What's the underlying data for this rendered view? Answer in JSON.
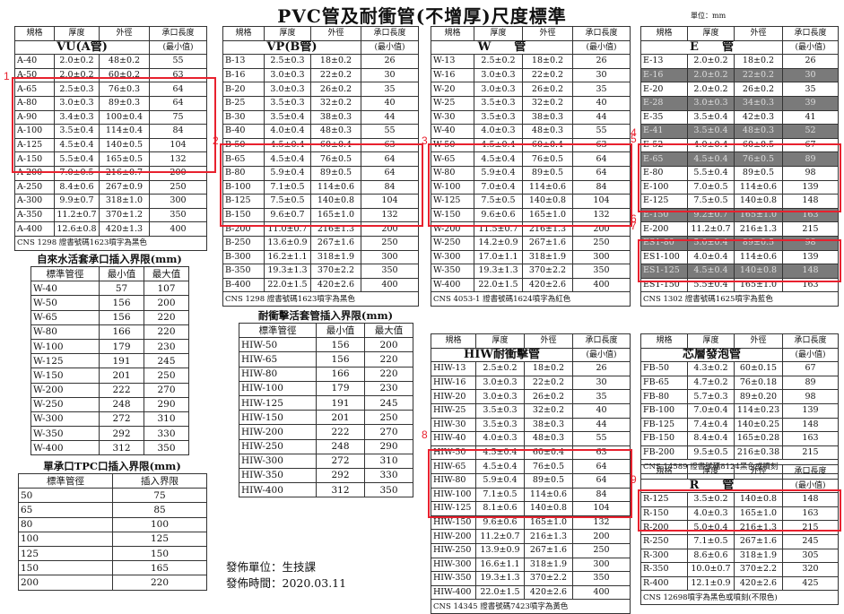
{
  "title": "PVC管及耐衝管(不增厚)尺度標準",
  "unit_label": "單位：mm",
  "headers": [
    "規格",
    "厚度",
    "外徑",
    "承口長度"
  ],
  "vu": {
    "name": "VU(A管)",
    "minlabel": "(最小值)",
    "rows": [
      [
        "A-40",
        "2.0±0.2",
        "48±0.2",
        "55"
      ],
      [
        "A-50",
        "2.0±0.2",
        "60±0.2",
        "63"
      ],
      [
        "A-65",
        "2.5±0.3",
        "76±0.3",
        "64"
      ],
      [
        "A-80",
        "3.0±0.3",
        "89±0.3",
        "64"
      ],
      [
        "A-90",
        "3.4±0.3",
        "100±0.4",
        "75"
      ],
      [
        "A-100",
        "3.5±0.4",
        "114±0.4",
        "84"
      ],
      [
        "A-125",
        "4.5±0.4",
        "140±0.5",
        "104"
      ],
      [
        "A-150",
        "5.5±0.4",
        "165±0.5",
        "132"
      ],
      [
        "A-200",
        "7.0±0.5",
        "216±0.7",
        "200"
      ],
      [
        "A-250",
        "8.4±0.6",
        "267±0.9",
        "250"
      ],
      [
        "A-300",
        "9.9±0.7",
        "318±1.0",
        "300"
      ],
      [
        "A-350",
        "11.2±0.7",
        "370±1.2",
        "350"
      ],
      [
        "A-400",
        "12.6±0.8",
        "420±1.3",
        "400"
      ]
    ],
    "note": "CNS 1298 證書號碼1623噴字為黑色"
  },
  "vp": {
    "name": "VP(B管)",
    "minlabel": "(最小值)",
    "rows": [
      [
        "B-13",
        "2.5±0.3",
        "18±0.2",
        "26"
      ],
      [
        "B-16",
        "3.0±0.3",
        "22±0.2",
        "30"
      ],
      [
        "B-20",
        "3.0±0.3",
        "26±0.2",
        "35"
      ],
      [
        "B-25",
        "3.5±0.3",
        "32±0.2",
        "40"
      ],
      [
        "B-30",
        "3.5±0.4",
        "38±0.3",
        "44"
      ],
      [
        "B-40",
        "4.0±0.4",
        "48±0.3",
        "55"
      ],
      [
        "B-50",
        "4.5±0.4",
        "60±0.4",
        "63"
      ],
      [
        "B-65",
        "4.5±0.4",
        "76±0.5",
        "64"
      ],
      [
        "B-80",
        "5.9±0.4",
        "89±0.5",
        "64"
      ],
      [
        "B-100",
        "7.1±0.5",
        "114±0.6",
        "84"
      ],
      [
        "B-125",
        "7.5±0.5",
        "140±0.8",
        "104"
      ],
      [
        "B-150",
        "9.6±0.7",
        "165±1.0",
        "132"
      ],
      [
        "B-200",
        "11.0±0.7",
        "216±1.3",
        "200"
      ],
      [
        "B-250",
        "13.6±0.9",
        "267±1.6",
        "250"
      ],
      [
        "B-300",
        "16.2±1.1",
        "318±1.9",
        "300"
      ],
      [
        "B-350",
        "19.3±1.3",
        "370±2.2",
        "350"
      ],
      [
        "B-400",
        "22.0±1.5",
        "420±2.6",
        "400"
      ]
    ],
    "note": "CNS 1298 證書號碼1623噴字為黑色"
  },
  "w": {
    "name": "W　　管",
    "minlabel": "(最小值)",
    "rows": [
      [
        "W-13",
        "2.5±0.2",
        "18±0.2",
        "26"
      ],
      [
        "W-16",
        "3.0±0.3",
        "22±0.2",
        "30"
      ],
      [
        "W-20",
        "3.0±0.3",
        "26±0.2",
        "35"
      ],
      [
        "W-25",
        "3.5±0.3",
        "32±0.2",
        "40"
      ],
      [
        "W-30",
        "3.5±0.3",
        "38±0.3",
        "44"
      ],
      [
        "W-40",
        "4.0±0.3",
        "48±0.3",
        "55"
      ],
      [
        "W-50",
        "4.5±0.4",
        "60±0.4",
        "63"
      ],
      [
        "W-65",
        "4.5±0.4",
        "76±0.5",
        "64"
      ],
      [
        "W-80",
        "5.9±0.4",
        "89±0.5",
        "64"
      ],
      [
        "W-100",
        "7.0±0.4",
        "114±0.6",
        "84"
      ],
      [
        "W-125",
        "7.5±0.5",
        "140±0.8",
        "104"
      ],
      [
        "W-150",
        "9.6±0.6",
        "165±1.0",
        "132"
      ],
      [
        "W-200",
        "11.5±0.7",
        "216±1.3",
        "200"
      ],
      [
        "W-250",
        "14.2±0.9",
        "267±1.6",
        "250"
      ],
      [
        "W-300",
        "17.0±1.1",
        "318±1.9",
        "300"
      ],
      [
        "W-350",
        "19.3±1.3",
        "370±2.2",
        "350"
      ],
      [
        "W-400",
        "22.0±1.5",
        "420±2.6",
        "400"
      ]
    ],
    "note": "CNS 4053-1 證書號碼1624噴字為紅色"
  },
  "e": {
    "name": "E　　管",
    "minlabel": "(最小值)",
    "rows": [
      [
        "E-13",
        "2.0±0.2",
        "18±0.2",
        "26"
      ],
      [
        "E-16",
        "2.0±0.2",
        "22±0.2",
        "30"
      ],
      [
        "E-20",
        "2.0±0.2",
        "26±0.2",
        "35"
      ],
      [
        "E-28",
        "3.0±0.3",
        "34±0.3",
        "39"
      ],
      [
        "E-35",
        "3.5±0.4",
        "42±0.3",
        "41"
      ],
      [
        "E-41",
        "3.5±0.4",
        "48±0.3",
        "52"
      ],
      [
        "E-52",
        "4.0±0.4",
        "60±0.5",
        "67"
      ],
      [
        "E-65",
        "4.5±0.4",
        "76±0.5",
        "89"
      ],
      [
        "E-80",
        "5.5±0.4",
        "89±0.5",
        "98"
      ],
      [
        "E-100",
        "7.0±0.5",
        "114±0.6",
        "139"
      ],
      [
        "E-125",
        "7.5±0.5",
        "140±0.8",
        "148"
      ],
      [
        "E-150",
        "9.2±0.7",
        "165±1.0",
        "163"
      ],
      [
        "E-200",
        "11.2±0.7",
        "216±1.3",
        "215"
      ],
      [
        "ES1-80",
        "5.0±0.4",
        "89±0.5",
        "98"
      ],
      [
        "ES1-100",
        "4.0±0.4",
        "114±0.6",
        "139"
      ],
      [
        "ES1-125",
        "4.5±0.4",
        "140±0.8",
        "148"
      ],
      [
        "ES1-150",
        "5.5±0.4",
        "165±1.0",
        "163"
      ]
    ],
    "note": "CNS 1302 證書號碼1625噴字為藍色"
  },
  "water": {
    "title": "自來水活套承口插入界限(mm)",
    "headers": [
      "標準管徑",
      "最小值",
      "最大值"
    ],
    "rows": [
      [
        "W-40",
        "57",
        "107"
      ],
      [
        "W-50",
        "156",
        "200"
      ],
      [
        "W-65",
        "156",
        "220"
      ],
      [
        "W-80",
        "166",
        "220"
      ],
      [
        "W-100",
        "179",
        "230"
      ],
      [
        "W-125",
        "191",
        "245"
      ],
      [
        "W-150",
        "201",
        "250"
      ],
      [
        "W-200",
        "222",
        "270"
      ],
      [
        "W-250",
        "248",
        "290"
      ],
      [
        "W-300",
        "272",
        "310"
      ],
      [
        "W-350",
        "292",
        "330"
      ],
      [
        "W-400",
        "312",
        "350"
      ]
    ]
  },
  "tpc": {
    "title": "單承口TPC口插入界限(mm)",
    "headers": [
      "標準管徑",
      "插入界限"
    ],
    "rows": [
      [
        "50",
        "75"
      ],
      [
        "65",
        "85"
      ],
      [
        "80",
        "100"
      ],
      [
        "100",
        "125"
      ],
      [
        "125",
        "150"
      ],
      [
        "150",
        "165"
      ],
      [
        "200",
        "220"
      ]
    ]
  },
  "hiw_insert": {
    "title": "耐衝擊活套管插入界限(mm)",
    "headers": [
      "標準管徑",
      "最小值",
      "最大值"
    ],
    "rows": [
      [
        "HIW-50",
        "156",
        "200"
      ],
      [
        "HIW-65",
        "156",
        "220"
      ],
      [
        "HIW-80",
        "166",
        "220"
      ],
      [
        "HIW-100",
        "179",
        "230"
      ],
      [
        "HIW-125",
        "191",
        "245"
      ],
      [
        "HIW-150",
        "201",
        "250"
      ],
      [
        "HIW-200",
        "222",
        "270"
      ],
      [
        "HIW-250",
        "248",
        "290"
      ],
      [
        "HIW-300",
        "272",
        "310"
      ],
      [
        "HIW-350",
        "292",
        "330"
      ],
      [
        "HIW-400",
        "312",
        "350"
      ]
    ]
  },
  "hiw": {
    "name": "HIW耐衝擊管",
    "minlabel": "(最小值)",
    "rows": [
      [
        "HIW-13",
        "2.5±0.2",
        "18±0.2",
        "26"
      ],
      [
        "HIW-16",
        "3.0±0.3",
        "22±0.2",
        "30"
      ],
      [
        "HIW-20",
        "3.0±0.3",
        "26±0.2",
        "35"
      ],
      [
        "HIW-25",
        "3.5±0.3",
        "32±0.2",
        "40"
      ],
      [
        "HIW-30",
        "3.5±0.3",
        "38±0.3",
        "44"
      ],
      [
        "HIW-40",
        "4.0±0.3",
        "48±0.3",
        "55"
      ],
      [
        "HIW-50",
        "4.5±0.4",
        "60±0.4",
        "63"
      ],
      [
        "HIW-65",
        "4.5±0.4",
        "76±0.5",
        "64"
      ],
      [
        "HIW-80",
        "5.9±0.4",
        "89±0.5",
        "64"
      ],
      [
        "HIW-100",
        "7.1±0.5",
        "114±0.6",
        "84"
      ],
      [
        "HIW-125",
        "8.1±0.6",
        "140±0.8",
        "104"
      ],
      [
        "HIW-150",
        "9.6±0.6",
        "165±1.0",
        "132"
      ],
      [
        "HIW-200",
        "11.2±0.7",
        "216±1.3",
        "200"
      ],
      [
        "HIW-250",
        "13.9±0.9",
        "267±1.6",
        "250"
      ],
      [
        "HIW-300",
        "16.6±1.1",
        "318±1.9",
        "300"
      ],
      [
        "HIW-350",
        "19.3±1.3",
        "370±2.2",
        "350"
      ],
      [
        "HIW-400",
        "22.0±1.5",
        "420±2.6",
        "400"
      ]
    ],
    "note": "CNS 14345 證書號碼7423噴字為黃色"
  },
  "fb": {
    "name": "芯層發泡管",
    "minlabel": "(最小值)",
    "rows": [
      [
        "FB-50",
        "4.3±0.2",
        "60±0.15",
        "67"
      ],
      [
        "FB-65",
        "4.7±0.2",
        "76±0.18",
        "89"
      ],
      [
        "FB-80",
        "5.7±0.3",
        "89±0.20",
        "98"
      ],
      [
        "FB-100",
        "7.0±0.4",
        "114±0.23",
        "139"
      ],
      [
        "FB-125",
        "7.4±0.4",
        "140±0.25",
        "148"
      ],
      [
        "FB-150",
        "8.4±0.4",
        "165±0.28",
        "163"
      ],
      [
        "FB-200",
        "9.5±0.5",
        "216±0.38",
        "215"
      ]
    ],
    "note": "CNS 14589 證書號碼8124黑色或噴刻"
  },
  "r": {
    "name": "R　　管",
    "minlabel": "(最小值)",
    "rows": [
      [
        "R-125",
        "3.5±0.2",
        "140±0.8",
        "148"
      ],
      [
        "R-150",
        "4.0±0.3",
        "165±1.0",
        "163"
      ],
      [
        "R-200",
        "5.0±0.4",
        "216±1.3",
        "215"
      ],
      [
        "R-250",
        "7.1±0.5",
        "267±1.6",
        "245"
      ],
      [
        "R-300",
        "8.6±0.6",
        "318±1.9",
        "305"
      ],
      [
        "R-350",
        "10.0±0.7",
        "370±2.2",
        "320"
      ],
      [
        "R-400",
        "12.1±0.9",
        "420±2.6",
        "425"
      ]
    ],
    "note": "CNS 12698噴字為黑色或噴刻(不限色)"
  },
  "publish": {
    "unit": "發佈單位：生技課",
    "date": "發佈時間：2020.03.11"
  },
  "marks": [
    "1",
    "2",
    "3",
    "4",
    "5",
    "6",
    "7",
    "8",
    "9"
  ],
  "highlight_color": "#e8212e"
}
